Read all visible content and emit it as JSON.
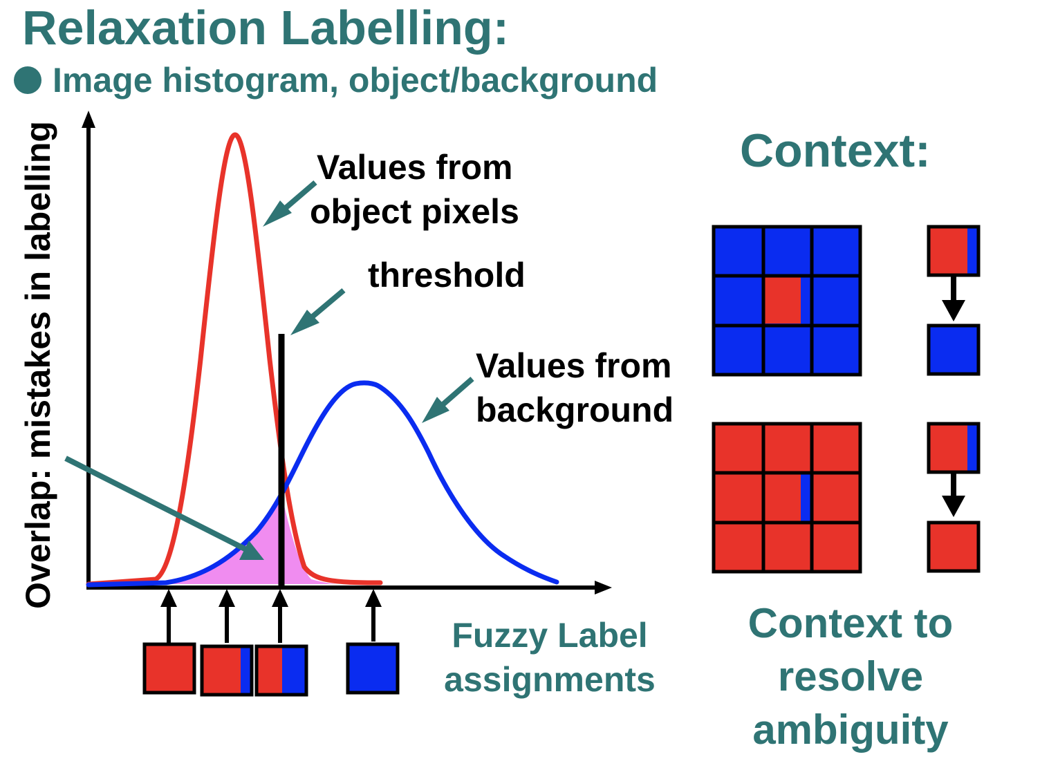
{
  "title": "Relaxation Labelling:",
  "bullet": "Image histogram, object/background",
  "y_axis_label": "Overlap: mistakes in labelling",
  "annotations": {
    "object_line1": "Values from",
    "object_line2": "object pixels",
    "threshold": "threshold",
    "background_line1": "Values from",
    "background_line2": "background",
    "fuzzy_line1": "Fuzzy Label",
    "fuzzy_line2": "assignments"
  },
  "context": {
    "heading": "Context:",
    "resolve_line1": "Context to",
    "resolve_line2": "resolve",
    "resolve_line3": "ambiguity"
  },
  "colors": {
    "teal": "#2f7474",
    "object_red": "#e8332a",
    "background_blue": "#0a2cf0",
    "overlap_pink": "#f08cf0"
  }
}
